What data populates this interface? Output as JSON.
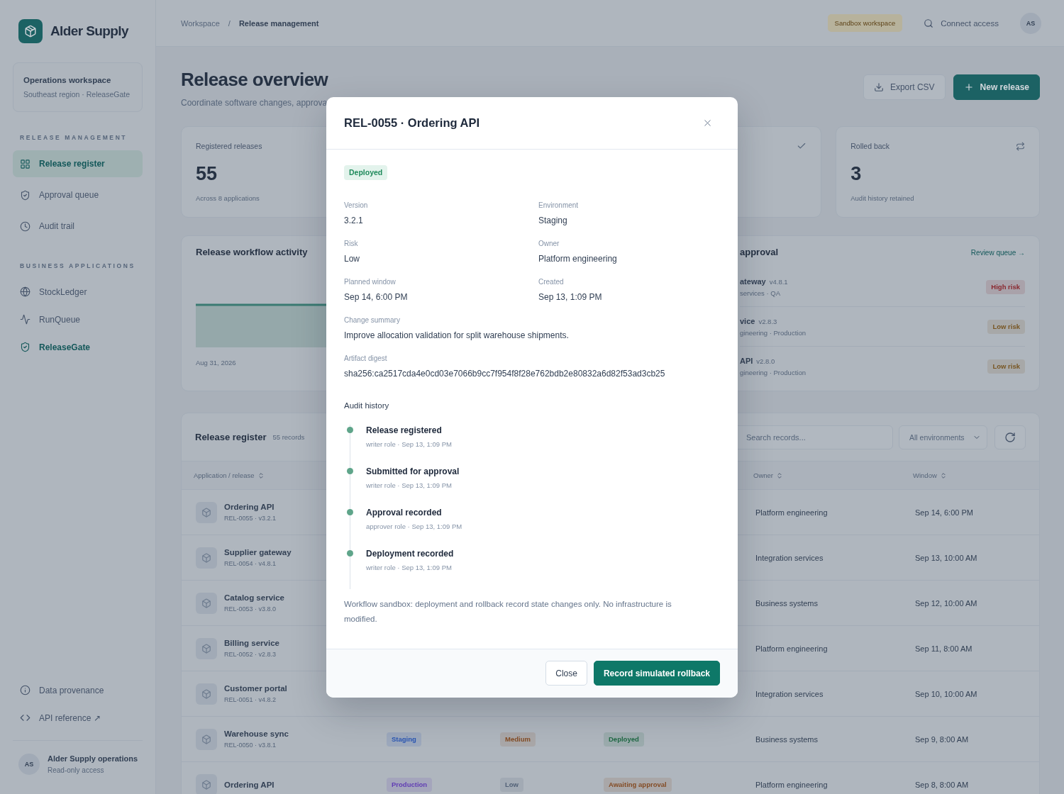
{
  "sidebar": {
    "brand": "Alder Supply",
    "workspace": {
      "title": "Operations workspace",
      "subtitle": "Southeast region · ReleaseGate"
    },
    "sections": [
      {
        "kind": "pages",
        "heading": "RELEASE MANAGEMENT",
        "items": [
          {
            "label": "Release register",
            "selected": true
          },
          {
            "label": "Approval queue",
            "selected": false
          },
          {
            "label": "Audit trail",
            "selected": false
          }
        ]
      },
      {
        "kind": "apps",
        "heading": "BUSINESS APPLICATIONS",
        "items": [
          {
            "label": "StockLedger",
            "selected": false
          },
          {
            "label": "RunQueue",
            "selected": false
          },
          {
            "label": "ReleaseGate",
            "selected": true
          }
        ]
      }
    ],
    "links": [
      {
        "label": "Data provenance"
      },
      {
        "label": "API reference ↗"
      }
    ],
    "account": {
      "initials": "AS",
      "name": "Alder Supply operations",
      "role": "Read-only access"
    }
  },
  "topbar": {
    "breadcrumb": [
      {
        "label": "Workspace",
        "selected": false
      },
      {
        "label": "Release management",
        "selected": true
      }
    ],
    "separator": "/",
    "badge": "Sandbox workspace",
    "link": "Connect access",
    "avatar": "AS"
  },
  "page": {
    "title": "Release overview",
    "subtitle": "Coordinate software changes, approva",
    "actions": [
      {
        "kind": "secondary",
        "label": "Export CSV"
      },
      {
        "kind": "primary",
        "label": "New release"
      }
    ]
  },
  "stats": [
    {
      "label": "Registered releases",
      "value": "55",
      "note": "Across 8 applications"
    },
    {
      "label": "Rolled back",
      "value": "3",
      "note": "Audit history retained"
    }
  ],
  "activity": {
    "title": "Release workflow activity",
    "axis_label": "Aug 31, 2026"
  },
  "approvals": {
    "title": "approval",
    "link": "Review queue →",
    "items": [
      {
        "name": "ateway",
        "version": "v4.8.1",
        "meta": "services · QA",
        "risk": {
          "text": "High risk",
          "color": "#8a2930"
        }
      },
      {
        "name": "vice",
        "version": "v2.8.3",
        "meta": "gineering · Production",
        "risk": {
          "text": "Low risk",
          "color": "#785623"
        }
      },
      {
        "name": "API",
        "version": "v2.8.0",
        "meta": "gineering · Production",
        "risk": {
          "text": "Low risk",
          "color": "#785623"
        }
      }
    ]
  },
  "register": {
    "title": "Release register",
    "count": "55 records",
    "search_placeholder": "Search records...",
    "filter": "All environments",
    "columns": [
      {
        "label": "Application / release"
      },
      null,
      null,
      null,
      {
        "label": "Owner"
      },
      {
        "label": "Window"
      }
    ],
    "rows": [
      {
        "name": "Ordering API",
        "release": "REL-0055 · v3.2.1",
        "owner": "Platform engineering",
        "window": "Sep 14, 6:00 PM"
      },
      {
        "name": "Supplier gateway",
        "release": "REL-0054 · v4.8.1",
        "owner": "Integration services",
        "window": "Sep 13, 10:00 AM"
      },
      {
        "name": "Catalog service",
        "release": "REL-0053 · v3.8.0",
        "owner": "Business systems",
        "window": "Sep 12, 10:00 AM"
      },
      {
        "name": "Billing service",
        "release": "REL-0052 · v2.8.3",
        "owner": "Platform engineering",
        "window": "Sep 11, 8:00 AM"
      },
      {
        "name": "Customer portal",
        "release": "REL-0051 · v4.8.2",
        "owner": "Integration services",
        "window": "Sep 10, 10:00 AM"
      },
      {
        "name": "Warehouse sync",
        "release": "REL-0050 · v3.8.1",
        "environment": {
          "text": "Staging",
          "color": "#2a56b3"
        },
        "risk": {
          "text": "Medium",
          "color": "#844c25"
        },
        "status": {
          "text": "Deployed",
          "color": "#206945"
        },
        "owner": "Business systems",
        "window": "Sep 9, 8:00 AM"
      },
      {
        "name": "Ordering API",
        "environment": {
          "text": "Production",
          "color": "#613db4"
        },
        "risk": {
          "text": "Low",
          "color": "#526177"
        },
        "status": {
          "text": "Awaiting approval",
          "color": "#844c25"
        },
        "owner": "Platform engineering",
        "window": "Sep 8, 8:00 AM"
      }
    ]
  },
  "modal": {
    "title": "REL-0055 · Ordering API",
    "status": "Deployed",
    "details": [
      {
        "label": "Version",
        "value": "3.2.1"
      },
      {
        "label": "Environment",
        "value": "Staging"
      },
      {
        "label": "Risk",
        "value": "Low"
      },
      {
        "label": "Owner",
        "value": "Platform engineering"
      },
      {
        "label": "Planned window",
        "value": "Sep 14, 6:00 PM"
      },
      {
        "label": "Created",
        "value": "Sep 13, 1:09 PM"
      }
    ],
    "descriptions": [
      {
        "label": "Change summary",
        "value": "Improve allocation validation for split warehouse shipments."
      },
      {
        "label": "Artifact digest",
        "value": "sha256:ca2517cda4e0cd03e7066b9cc7f954f8f28e762bdb2e80832a6d82f53ad3cb25"
      }
    ],
    "history_title": "Audit history",
    "history": [
      {
        "title": "Release registered",
        "meta": "writer role · Sep 13, 1:09 PM"
      },
      {
        "title": "Submitted for approval",
        "meta": "writer role · Sep 13, 1:09 PM"
      },
      {
        "title": "Approval recorded",
        "meta": "approver role · Sep 13, 1:09 PM"
      },
      {
        "title": "Deployment recorded",
        "meta": "writer role · Sep 13, 1:09 PM"
      }
    ],
    "note": "Workflow sandbox: deployment and rollback record state changes only. No infrastructure is modified.",
    "buttons": [
      {
        "kind": "secondary",
        "label": "Close"
      },
      {
        "kind": "primary",
        "label": "Record simulated rollback"
      }
    ]
  }
}
